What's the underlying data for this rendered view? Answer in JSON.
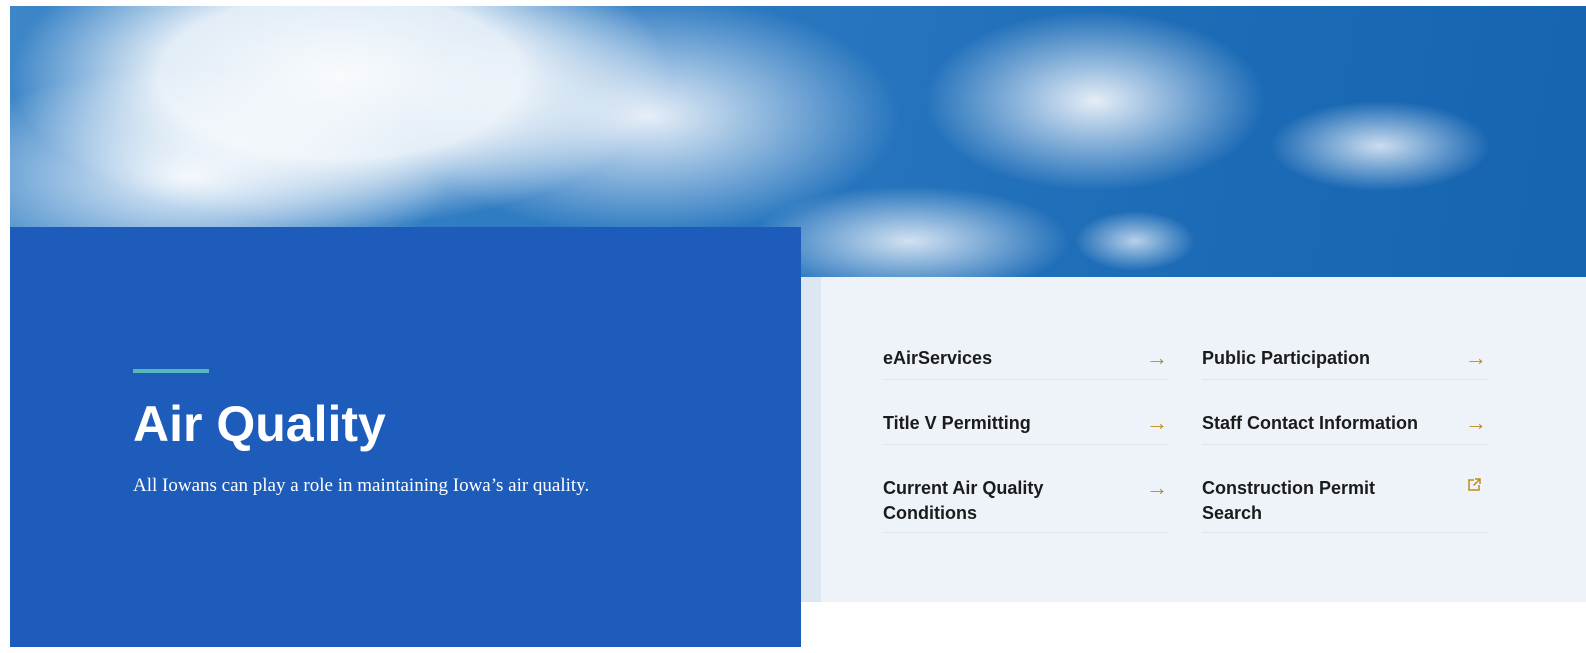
{
  "hero": {
    "title": "Air Quality",
    "subtitle": "All Iowans can play a role in maintaining Iowa’s air quality."
  },
  "quick_links": [
    {
      "label": "eAirServices",
      "icon": "arrow-right-icon"
    },
    {
      "label": "Public Participation",
      "icon": "arrow-right-icon"
    },
    {
      "label": "Title V Permitting",
      "icon": "arrow-right-icon"
    },
    {
      "label": "Staff Contact Information",
      "icon": "arrow-right-icon"
    },
    {
      "label": "Current Air Quality Conditions",
      "icon": "arrow-right-icon"
    },
    {
      "label": "Construction Permit Search",
      "icon": "external-link-icon"
    }
  ],
  "icons": {
    "arrow": "→"
  },
  "colors": {
    "panel_blue": "#1d5cbb",
    "accent_teal": "#58b8b7",
    "arrow_gold": "#c08a1a",
    "links_background": "#eef3f9"
  }
}
